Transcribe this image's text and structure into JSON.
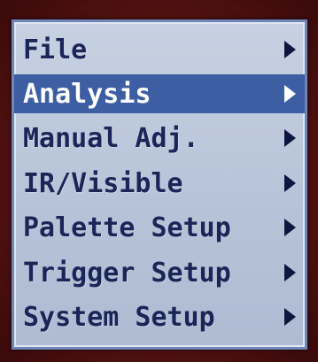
{
  "menu": {
    "items": [
      {
        "label": "File",
        "icon": "chevron-right-icon"
      },
      {
        "label": "Analysis",
        "icon": "chevron-right-icon",
        "selected": true
      },
      {
        "label": "Manual Adj.",
        "icon": "chevron-right-icon"
      },
      {
        "label": "IR/Visible",
        "icon": "chevron-right-icon"
      },
      {
        "label": "Palette Setup",
        "icon": "chevron-right-icon"
      },
      {
        "label": "Trigger Setup",
        "icon": "chevron-right-icon"
      },
      {
        "label": "System Setup",
        "icon": "chevron-right-icon"
      }
    ]
  },
  "colors": {
    "menu_background": "#b7c3d8",
    "selected_background": "#3d5ea3",
    "text": "#1a2558",
    "selected_text": "#ffffff",
    "bezel": "#5a1414"
  }
}
